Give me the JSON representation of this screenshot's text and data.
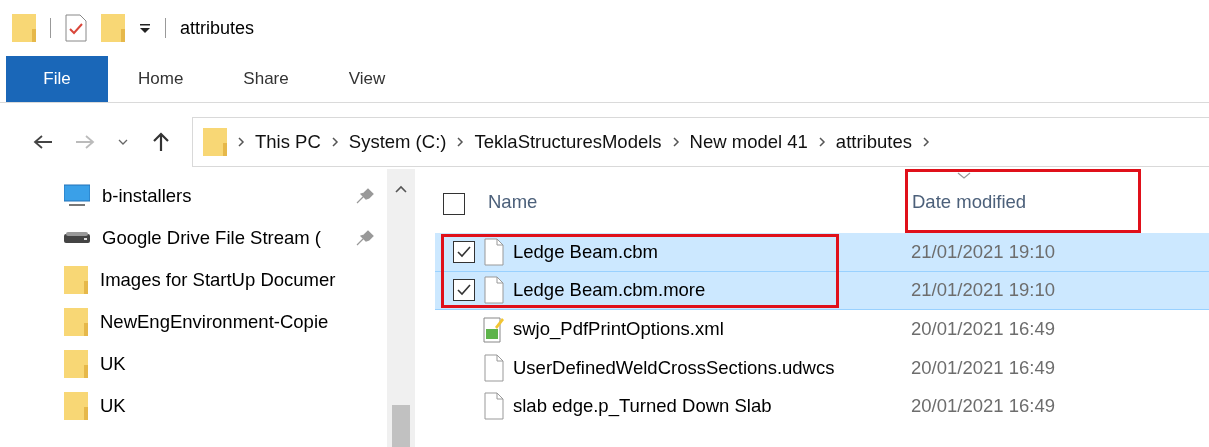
{
  "title_bar": {
    "title": "attributes"
  },
  "ribbon_tabs": [
    {
      "label": "File",
      "selected": true
    },
    {
      "label": "Home",
      "selected": false
    },
    {
      "label": "Share",
      "selected": false
    },
    {
      "label": "View",
      "selected": false
    }
  ],
  "navigation": {
    "forward_disabled": true
  },
  "address": {
    "segments": [
      "This PC",
      "System (C:)",
      "TeklaStructuresModels",
      "New model 41",
      "attributes"
    ]
  },
  "nav_pane": {
    "items": [
      {
        "label": "b-installers",
        "kind": "desktop",
        "pinned": true
      },
      {
        "label": "Google Drive File Stream (",
        "kind": "drive",
        "pinned": true
      },
      {
        "label": "Images for StartUp Documer",
        "kind": "folder",
        "pinned": false
      },
      {
        "label": "NewEngEnvironment-Copie",
        "kind": "folder",
        "pinned": false
      },
      {
        "label": "UK",
        "kind": "folder",
        "pinned": false
      },
      {
        "label": "UK",
        "kind": "folder",
        "pinned": false
      }
    ]
  },
  "file_list": {
    "select_all_checked": false,
    "columns": [
      {
        "label": "Name",
        "highlighted": false,
        "sorted": false
      },
      {
        "label": "Date modified",
        "highlighted": true,
        "sorted": true
      }
    ],
    "rows": [
      {
        "name": "Ledge Beam.cbm",
        "date": "21/01/2021 19:10",
        "kind": "file",
        "selected": true,
        "highlighted": true
      },
      {
        "name": "Ledge Beam.cbm.more",
        "date": "21/01/2021 19:10",
        "kind": "file",
        "selected": true,
        "highlighted": true
      },
      {
        "name": "swjo_PdfPrintOptions.xml",
        "date": "20/01/2021 16:49",
        "kind": "xml",
        "selected": false,
        "highlighted": false
      },
      {
        "name": "UserDefinedWeldCrossSections.udwcs",
        "date": "20/01/2021 16:49",
        "kind": "file",
        "selected": false,
        "highlighted": false
      },
      {
        "name": "slab edge.p_Turned Down Slab",
        "date": "20/01/2021 16:49",
        "kind": "file",
        "selected": false,
        "highlighted": false
      }
    ]
  }
}
